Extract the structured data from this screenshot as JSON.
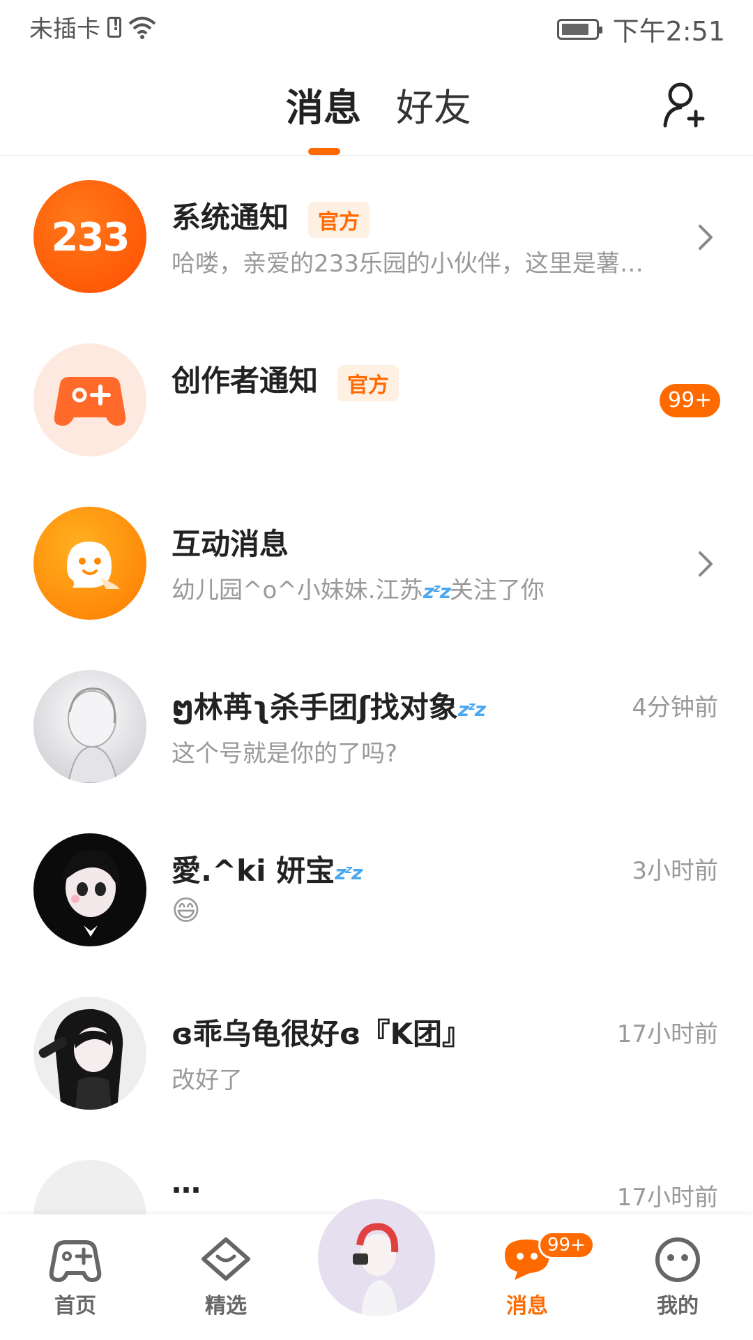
{
  "status_bar": {
    "carrier": "未插卡",
    "time": "下午2:51"
  },
  "header": {
    "tabs": [
      {
        "label": "消息",
        "active": true
      },
      {
        "label": "好友",
        "active": false
      }
    ],
    "add_friend_icon": "add-user-icon"
  },
  "messages": [
    {
      "name": "系统通知",
      "tag": "官方",
      "preview": "哈喽，亲爱的233乐园的小伙伴，这里是薯…",
      "time": "",
      "chevron": true,
      "avatar_text": "233"
    },
    {
      "name": "创作者通知",
      "tag": "官方",
      "preview": "",
      "time": "",
      "count": "99+"
    },
    {
      "name": "互动消息",
      "tag": "",
      "preview_prefix": "幼儿园^o^小妹妹.江苏",
      "preview_suffix": "关注了你",
      "chevron": true
    },
    {
      "name_a": "ໆ林苒",
      "name_b": "ʅ杀手团ʃ",
      "name_c": "找对象",
      "preview": "这个号就是你的了吗?",
      "time": "4分钟前"
    },
    {
      "name": "愛.^ki 妍宝",
      "preview": "😄",
      "time": "3小时前"
    },
    {
      "name": "ɞ乖乌龟很好ɞ『K团』",
      "preview": "改好了",
      "time": "17小时前"
    },
    {
      "name": "…",
      "preview": "",
      "time": "17小时前"
    }
  ],
  "bottom_nav": {
    "items": [
      {
        "label": "首页",
        "icon": "gamepad-icon",
        "active": false
      },
      {
        "label": "精选",
        "icon": "heart-chat-icon",
        "active": false
      },
      {
        "label": "消息",
        "icon": "message-icon",
        "active": true,
        "badge": "99+"
      },
      {
        "label": "我的",
        "icon": "face-icon",
        "active": false
      }
    ]
  },
  "colors": {
    "accent": "#ff6a00",
    "text_primary": "#222222",
    "text_secondary": "#999999"
  }
}
